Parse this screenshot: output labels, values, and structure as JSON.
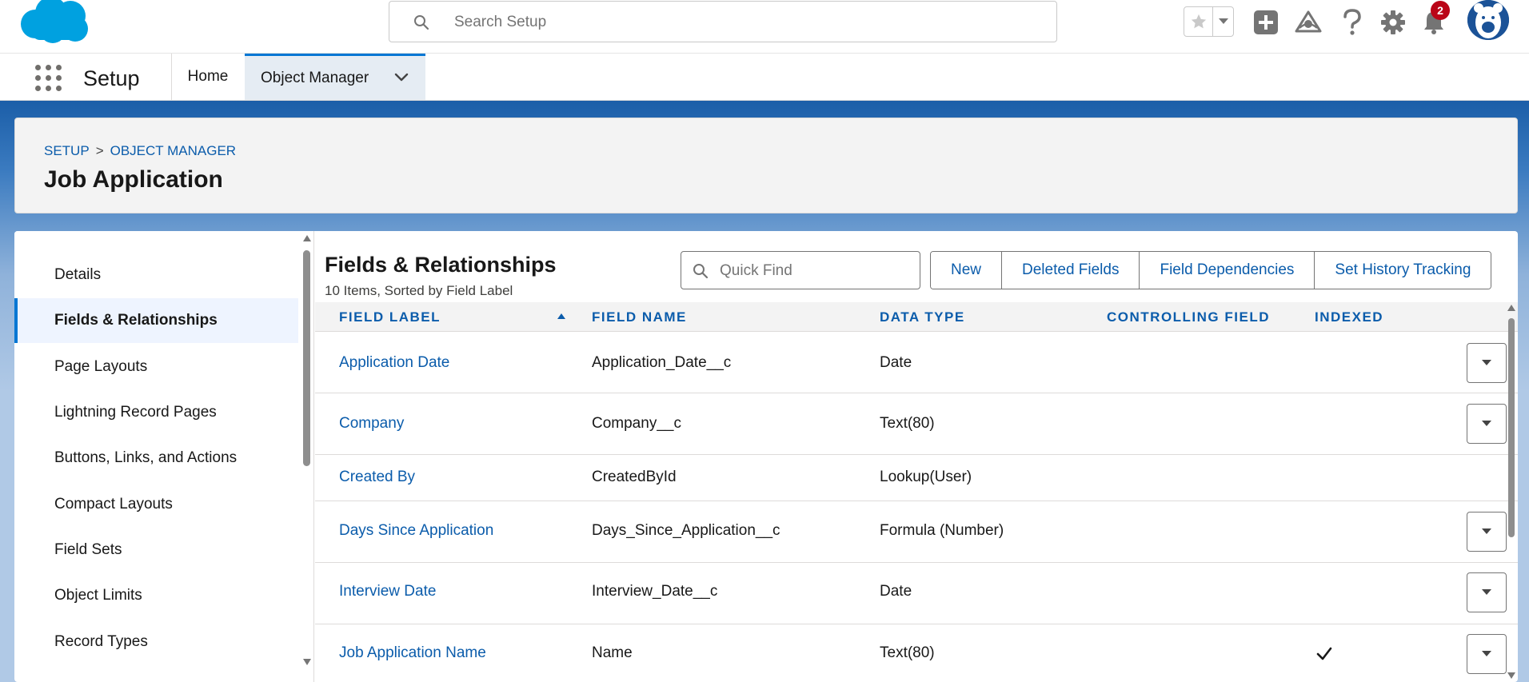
{
  "header": {
    "search_placeholder": "Search Setup",
    "notification_count": "2"
  },
  "context_bar": {
    "app_name": "Setup",
    "tabs": [
      {
        "label": "Home"
      },
      {
        "label": "Object Manager"
      }
    ]
  },
  "page_header": {
    "breadcrumb": [
      "SETUP",
      "OBJECT MANAGER"
    ],
    "breadcrumb_separator": ">",
    "title": "Job Application"
  },
  "sidebar": {
    "items": [
      {
        "label": "Details"
      },
      {
        "label": "Fields & Relationships"
      },
      {
        "label": "Page Layouts"
      },
      {
        "label": "Lightning Record Pages"
      },
      {
        "label": "Buttons, Links, and Actions"
      },
      {
        "label": "Compact Layouts"
      },
      {
        "label": "Field Sets"
      },
      {
        "label": "Object Limits"
      },
      {
        "label": "Record Types"
      }
    ]
  },
  "fields": {
    "title": "Fields & Relationships",
    "subtitle": "10 Items, Sorted by Field Label",
    "quick_find_placeholder": "Quick Find",
    "buttons": [
      "New",
      "Deleted Fields",
      "Field Dependencies",
      "Set History Tracking"
    ],
    "columns": [
      "FIELD LABEL",
      "FIELD NAME",
      "DATA TYPE",
      "CONTROLLING FIELD",
      "INDEXED"
    ],
    "rows": [
      {
        "label": "Application Date",
        "name": "Application_Date__c",
        "type": "Date",
        "controlling": "",
        "indexed": false,
        "action": true
      },
      {
        "label": "Company",
        "name": "Company__c",
        "type": "Text(80)",
        "controlling": "",
        "indexed": false,
        "action": true
      },
      {
        "label": "Created By",
        "name": "CreatedById",
        "type": "Lookup(User)",
        "controlling": "",
        "indexed": false,
        "action": false
      },
      {
        "label": "Days Since Application",
        "name": "Days_Since_Application__c",
        "type": "Formula (Number)",
        "controlling": "",
        "indexed": false,
        "action": true
      },
      {
        "label": "Interview Date",
        "name": "Interview_Date__c",
        "type": "Date",
        "controlling": "",
        "indexed": false,
        "action": true
      },
      {
        "label": "Job Application Name",
        "name": "Name",
        "type": "Text(80)",
        "controlling": "",
        "indexed": true,
        "action": true
      }
    ]
  },
  "colors": {
    "brand": "#0176d3",
    "link": "#0b5cab",
    "logo": "#00a1e0"
  }
}
